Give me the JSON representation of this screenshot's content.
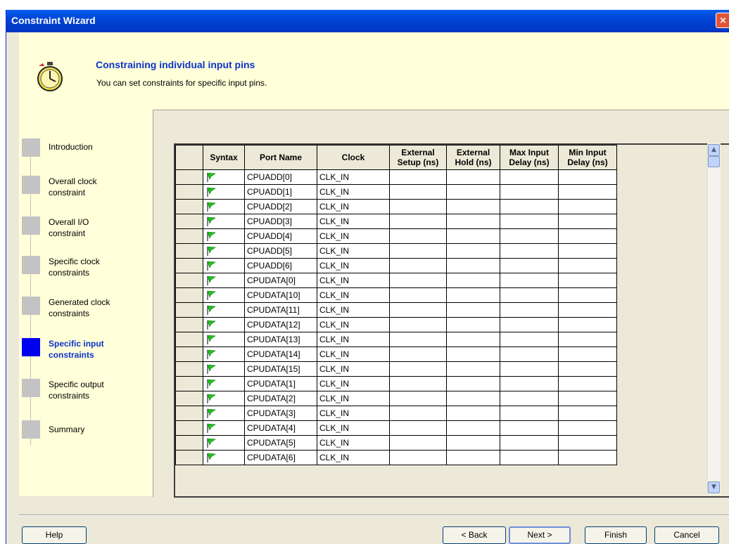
{
  "window": {
    "title": "Constraint Wizard",
    "close_icon": "×"
  },
  "header": {
    "title": "Constraining individual input pins",
    "subtitle": "You can set constraints for specific input pins."
  },
  "steps": [
    {
      "label": "Introduction",
      "active": false
    },
    {
      "label": "Overall clock constraint",
      "active": false
    },
    {
      "label": "Overall I/O constraint",
      "active": false
    },
    {
      "label": "Specific clock constraints",
      "active": false
    },
    {
      "label": "Generated clock constraints",
      "active": false
    },
    {
      "label": "Specific input constraints",
      "active": true
    },
    {
      "label": "Specific output constraints",
      "active": false
    },
    {
      "label": "Summary",
      "active": false
    }
  ],
  "table": {
    "columns": [
      "Syntax",
      "Port Name",
      "Clock",
      "External Setup (ns)",
      "External Hold (ns)",
      "Max Input Delay (ns)",
      "Min Input Delay (ns)"
    ],
    "column_lines": [
      [
        "Syntax"
      ],
      [
        "Port Name"
      ],
      [
        "Clock"
      ],
      [
        "External",
        "Setup (ns)"
      ],
      [
        "External",
        "Hold (ns)"
      ],
      [
        "Max Input",
        "Delay (ns)"
      ],
      [
        "Min Input",
        "Delay (ns)"
      ]
    ],
    "rows": [
      {
        "port": "CPUADD[0]",
        "clock": "CLK_IN"
      },
      {
        "port": "CPUADD[1]",
        "clock": "CLK_IN"
      },
      {
        "port": "CPUADD[2]",
        "clock": "CLK_IN"
      },
      {
        "port": "CPUADD[3]",
        "clock": "CLK_IN"
      },
      {
        "port": "CPUADD[4]",
        "clock": "CLK_IN"
      },
      {
        "port": "CPUADD[5]",
        "clock": "CLK_IN"
      },
      {
        "port": "CPUADD[6]",
        "clock": "CLK_IN"
      },
      {
        "port": "CPUDATA[0]",
        "clock": "CLK_IN"
      },
      {
        "port": "CPUDATA[10]",
        "clock": "CLK_IN"
      },
      {
        "port": "CPUDATA[11]",
        "clock": "CLK_IN"
      },
      {
        "port": "CPUDATA[12]",
        "clock": "CLK_IN"
      },
      {
        "port": "CPUDATA[13]",
        "clock": "CLK_IN"
      },
      {
        "port": "CPUDATA[14]",
        "clock": "CLK_IN"
      },
      {
        "port": "CPUDATA[15]",
        "clock": "CLK_IN"
      },
      {
        "port": "CPUDATA[1]",
        "clock": "CLK_IN"
      },
      {
        "port": "CPUDATA[2]",
        "clock": "CLK_IN"
      },
      {
        "port": "CPUDATA[3]",
        "clock": "CLK_IN"
      },
      {
        "port": "CPUDATA[4]",
        "clock": "CLK_IN"
      },
      {
        "port": "CPUDATA[5]",
        "clock": "CLK_IN"
      },
      {
        "port": "CPUDATA[6]",
        "clock": "CLK_IN"
      }
    ],
    "syntax_icon": "green-flag-icon"
  },
  "buttons": {
    "help": "Help",
    "back": "< Back",
    "next": "Next >",
    "finish": "Finish",
    "cancel": "Cancel"
  },
  "colors": {
    "titlebar": "#0044d6",
    "header_bg": "#ffffd9",
    "active_step": "#0000f0",
    "title_text": "#0b33cc",
    "flag": "#22c022"
  }
}
